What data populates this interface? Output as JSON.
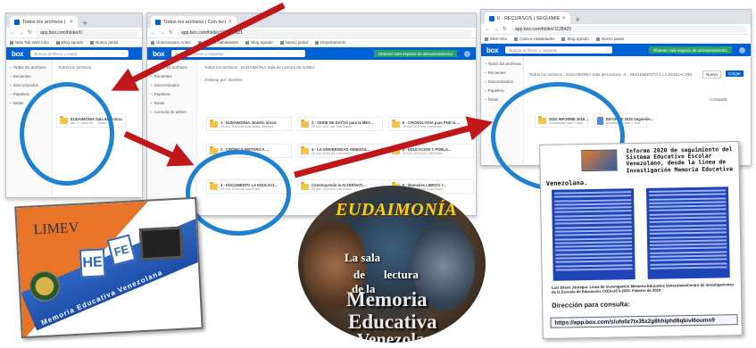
{
  "colors": {
    "box_blue": "#0061d5",
    "circle_blue": "#1e82d2",
    "arrow_red": "#c0171a",
    "report_blue": "#1f44b8",
    "eudaimonia_yellow": "#f4d21c"
  },
  "shot_left": {
    "tab": "Todos los archivos | Con tecnolo",
    "url": "app.box.com/folder/0",
    "bookmarks": [
      "New Tab Web Inbo",
      "Blog agrado",
      "Nuevo pedal"
    ],
    "search_placeholder": "Buscar archivos y carpe",
    "crumb": "Todos los archivos",
    "sidebar": [
      "Todos los archivos",
      "Recientes",
      "Sincronizados",
      "Papelera",
      "Notas"
    ],
    "item": {
      "title": "EUDAIMONIA Sala de lectura",
      "meta": "abr. 17 hace ca. ... horas"
    }
  },
  "shot_mid": {
    "tab": "Todos los archivos | Con tecnolo",
    "url": "app.box.com/folder/102084521",
    "bookmarks": [
      "Unnecessary Anten",
      "Casa a Habitidades",
      "Blog agrado",
      "Nuevo pedal",
      "Departamento"
    ],
    "search_placeholder": "Buscar archivos y carpetas",
    "green_button": "Obtener más espacio de almacenamiento",
    "crumb": "Todos los archivos  ›  EUDAIMONIA Sala de Lectura de la MEV",
    "sort_label": "Ordenar por: Nombre",
    "sidebar": [
      "Todos los archivos",
      "Recientes",
      "Sincronizados",
      "Papelera",
      "Notas",
      "Consola de admin"
    ],
    "items": [
      {
        "title": "1 - EUDAIMONIA. Boletín inicial",
        "meta": "20 nov. 2019 por Luis Bravo Jáuregui"
      },
      {
        "title": "2 - CRÓNICA HISTÓRICA ...",
        "meta": "20 nov. 2019 por Luis Bravo"
      },
      {
        "title": "3 - DOCUMENTO LA EDUCACI...",
        "meta": "20 nov. 2019 por Luis Bravo"
      },
      {
        "title": "2 - SERIE DE DATOS para la MEV...",
        "meta": "20 nov. 2019 por Luis Bravo"
      },
      {
        "title": "4 - LA UNIVERSIDAD VENEZOL...",
        "meta": "20 nov. 2019 por Luis Bravo"
      },
      {
        "title": "Construyendo la ALTERNATI...",
        "meta": "20 nov. 2019 por Luis Bravo"
      },
      {
        "title": "6 - CRONOLOGÍA para PND la ...",
        "meta": "20 nov. 2019 por Luis Bravo"
      },
      {
        "title": "5 - EDUCACIÓN Y POBLA...",
        "meta": "20 nov. 2019 por Luis Bravo"
      },
      {
        "title": "8 - Manuales LIBROS Y...",
        "meta": "20 nov. 2019 por Luis Bravo"
      }
    ]
  },
  "shot_right": {
    "tab": "6 - RECURSOS | SEGUIMIENTO Y",
    "url": "app.box.com/folder/1128425",
    "bookmarks": [
      "Web Inbo",
      "Casa a Habitidades",
      "Blog agrado",
      "Nuevo pedal"
    ],
    "search_placeholder": "Buscar archivos y carpetas",
    "green_button": "Obtener más espacio de almacenamiento",
    "crumb": "Todos los archivos  ›  EUDAIMONIA Sala de Lectura  ›  6 - SEGUIMIENTO A LA EDUCACIÓN",
    "sidebar": [
      "Todos los archivos",
      "Recientes",
      "Sincronizados",
      "Papelera",
      "Notas"
    ],
    "items": [
      {
        "title": "2020 INFORME 2019 ...",
        "meta": "Actualizado hace 2 días"
      },
      {
        "title": "INFORME 2020 Seguimie...",
        "meta": "Actualizado hace 2 días"
      }
    ],
    "new_button": "Nuevo",
    "upload_button": "Cargar",
    "sharing_label": "Compartir"
  },
  "limev": {
    "brand": "LIMEV",
    "he": "HE",
    "fe": "FE",
    "tagline": "Memoria Educativa Venezolana"
  },
  "eudaimonia": {
    "title": "EUDAIMONÍA",
    "line1": "La sala",
    "line2": "de",
    "line3": "lectura",
    "line4": "de la",
    "big1": "Memoria",
    "big2": "Educativa",
    "big3": "Venezolana"
  },
  "report": {
    "title": "Informe 2020 de seguimiento del Sistema Educativo Escolar Venezolano, desde la línea de Investigación Memoria Educativa",
    "subtitle_word": "Venezolana.",
    "author": "Luis Bravo Jáuregui. Línea de Investigación Memoria Educativa Venezolana/Centro de Investigaciones de la Escuela de Educación. CIES-UCV-2020. Febrero de 2020",
    "consult_label": "Dirección para consulta:",
    "link": "https://app.box.com/s/ufo0z7tx35z2g8hhiphd6qbivl6oumn9"
  }
}
